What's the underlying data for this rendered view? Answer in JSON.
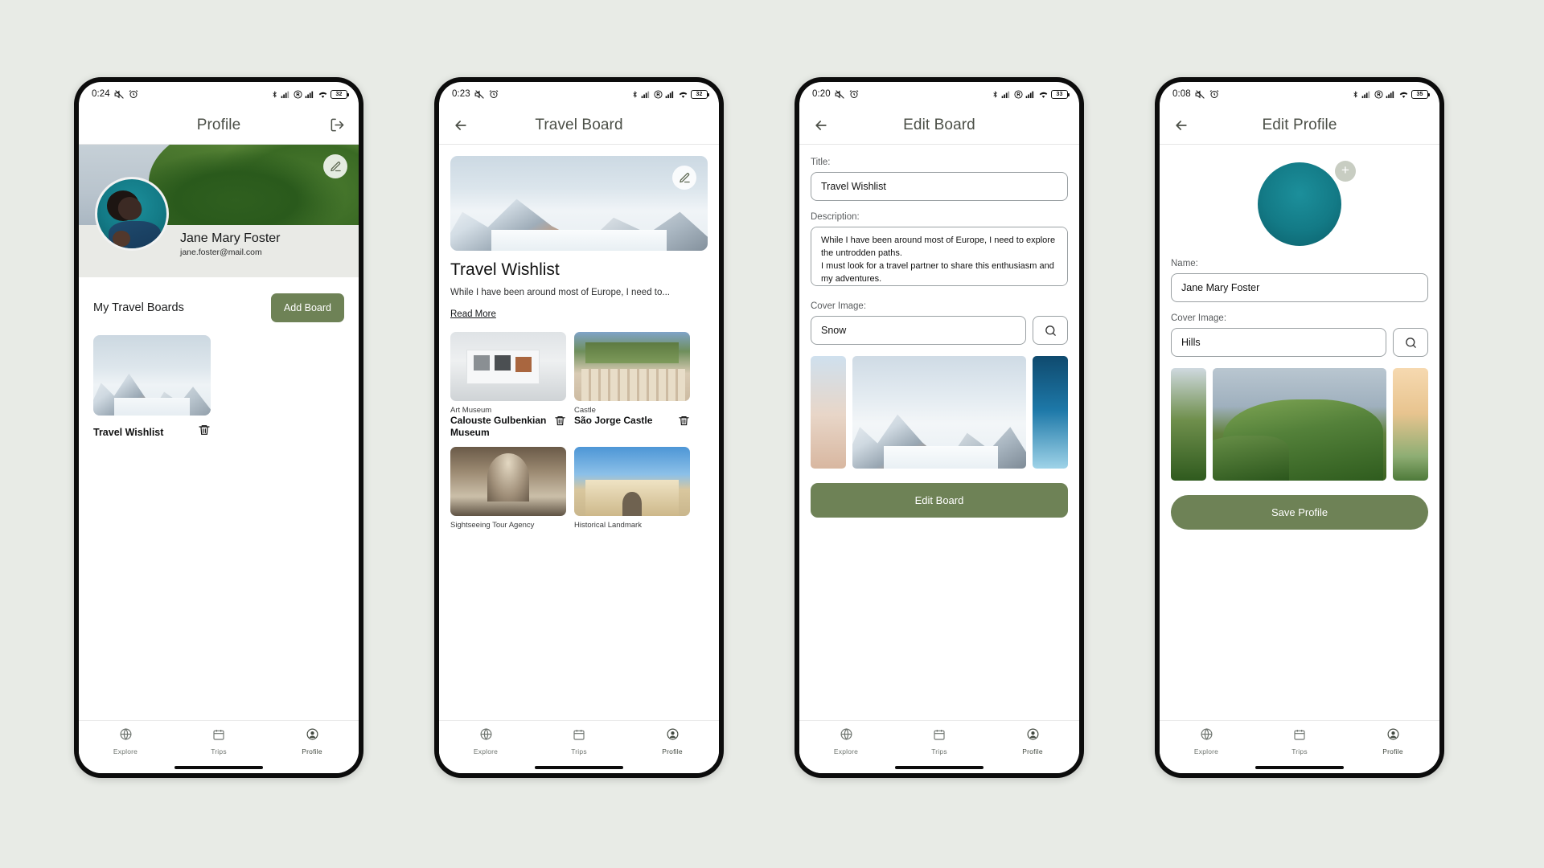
{
  "app": {
    "accent_green": "#6e8256",
    "bg": "#e8ebe6"
  },
  "panels": [
    {
      "id": "profile",
      "statusbar": {
        "time": "0:24",
        "battery": "32"
      },
      "appbar": {
        "title": "Profile",
        "right_icon": "logout-icon"
      },
      "profile": {
        "name": "Jane Mary Foster",
        "email": "jane.foster@mail.com",
        "edit_icon": "pencil-icon"
      },
      "boards": {
        "section_title": "My Travel Boards",
        "add_button": "Add Board",
        "items": [
          {
            "name": "Travel Wishlist",
            "delete_icon": "trash-icon"
          }
        ]
      },
      "nav": {
        "items": [
          "Explore",
          "Trips",
          "Profile"
        ],
        "active": "Profile"
      }
    },
    {
      "id": "travel-board",
      "statusbar": {
        "time": "0:23",
        "battery": "32"
      },
      "appbar": {
        "title": "Travel Board",
        "left_icon": "back-arrow-icon"
      },
      "board": {
        "title": "Travel Wishlist",
        "description": "While I have been around most of Europe, I need to...",
        "read_more": "Read More",
        "edit_icon": "pencil-icon"
      },
      "places": [
        {
          "category": "Art Museum",
          "name": "Calouste Gulbenkian Museum",
          "delete_icon": "trash-icon"
        },
        {
          "category": "Castle",
          "name": "São Jorge Castle",
          "delete_icon": "trash-icon"
        },
        {
          "category": "Sightseeing Tour Agency",
          "name": "",
          "delete_icon": "trash-icon"
        },
        {
          "category": "Historical Landmark",
          "name": "",
          "delete_icon": "trash-icon"
        }
      ],
      "nav": {
        "items": [
          "Explore",
          "Trips",
          "Profile"
        ],
        "active": "Profile"
      }
    },
    {
      "id": "edit-board",
      "statusbar": {
        "time": "0:20",
        "battery": "33"
      },
      "appbar": {
        "title": "Edit Board",
        "left_icon": "back-arrow-icon"
      },
      "form": {
        "title_label": "Title:",
        "title_value": "Travel Wishlist",
        "description_label": "Description:",
        "description_value": "While I have been around most of Europe, I need to explore the untrodden paths.\nI must look for a travel partner to share this enthusiasm and my adventures.",
        "cover_label": "Cover Image:",
        "cover_value": "Snow",
        "search_icon": "search-icon",
        "submit": "Edit Board"
      },
      "nav": {
        "items": [
          "Explore",
          "Trips",
          "Profile"
        ],
        "active": "Profile"
      }
    },
    {
      "id": "edit-profile",
      "statusbar": {
        "time": "0:08",
        "battery": "35"
      },
      "appbar": {
        "title": "Edit Profile",
        "left_icon": "back-arrow-icon"
      },
      "form": {
        "avatar_add_icon": "plus-icon",
        "name_label": "Name:",
        "name_value": "Jane Mary Foster",
        "cover_label": "Cover Image:",
        "cover_value": "Hills",
        "search_icon": "search-icon",
        "submit": "Save Profile"
      },
      "nav": {
        "items": [
          "Explore",
          "Trips",
          "Profile"
        ],
        "active": "Profile"
      }
    }
  ]
}
